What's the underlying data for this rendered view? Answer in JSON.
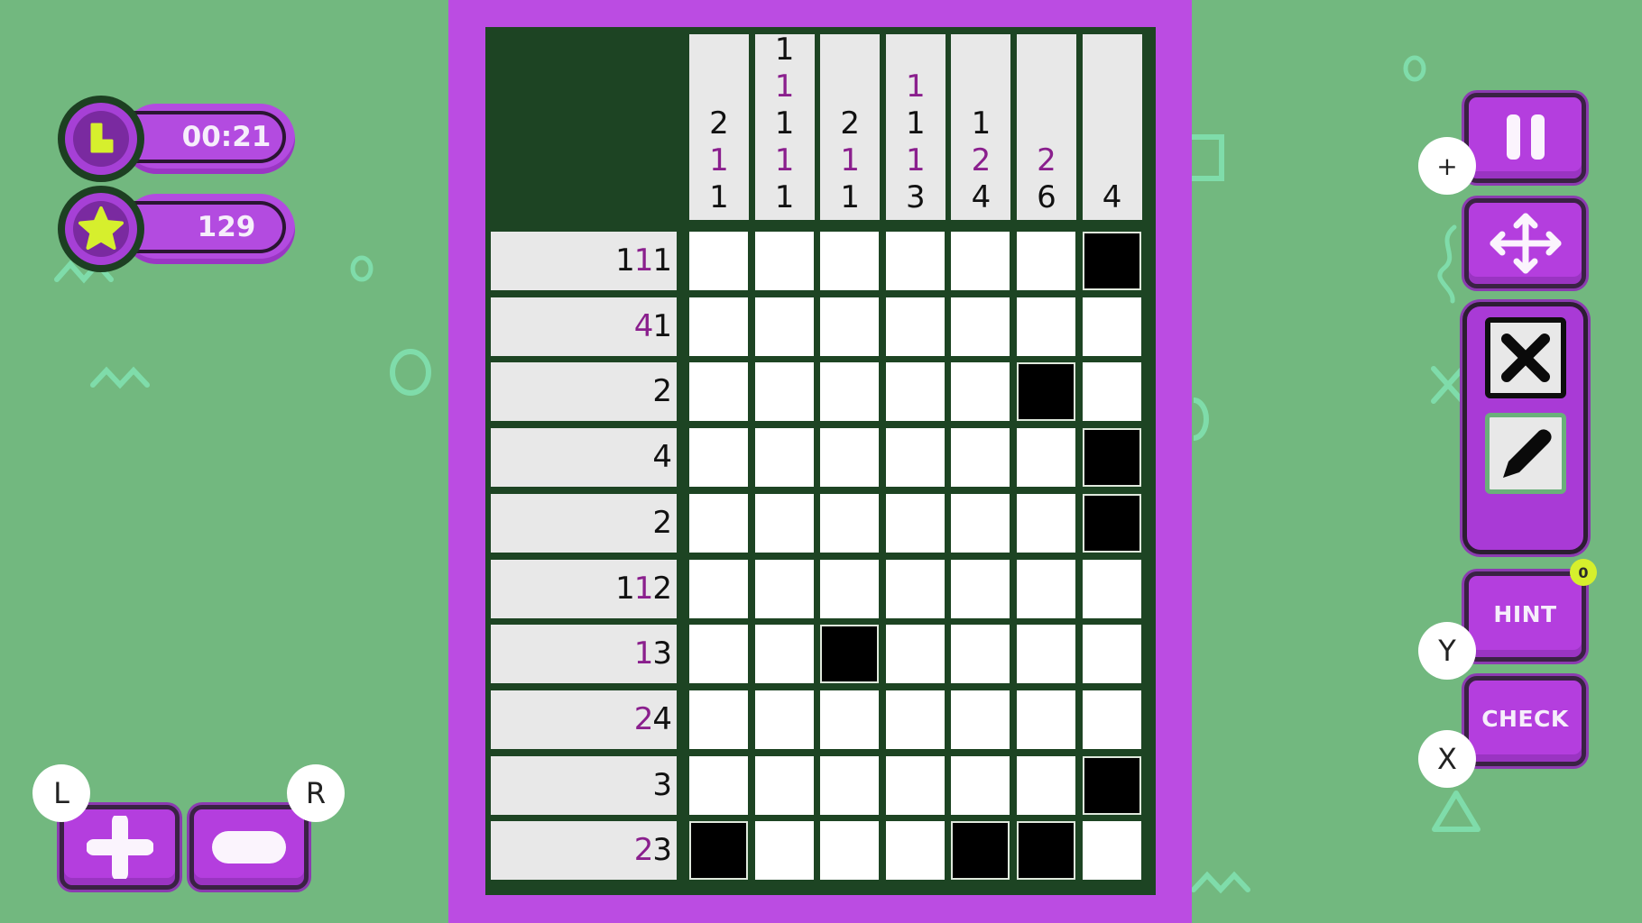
{
  "hud": {
    "timer": {
      "icon": "clock-icon",
      "value": "00:21"
    },
    "score": {
      "icon": "star-icon",
      "value": "129"
    }
  },
  "puzzle": {
    "rows": 10,
    "cols": 7,
    "column_clues": [
      [
        {
          "n": "2",
          "hl": false
        },
        {
          "n": "1",
          "hl": true
        },
        {
          "n": "1",
          "hl": false
        }
      ],
      [
        {
          "n": "1",
          "hl": false
        },
        {
          "n": "1",
          "hl": true
        },
        {
          "n": "1",
          "hl": false
        },
        {
          "n": "1",
          "hl": true
        },
        {
          "n": "1",
          "hl": false
        }
      ],
      [
        {
          "n": "2",
          "hl": false
        },
        {
          "n": "1",
          "hl": true
        },
        {
          "n": "1",
          "hl": false
        }
      ],
      [
        {
          "n": "1",
          "hl": true
        },
        {
          "n": "1",
          "hl": false
        },
        {
          "n": "1",
          "hl": true
        },
        {
          "n": "3",
          "hl": false
        }
      ],
      [
        {
          "n": "1",
          "hl": false
        },
        {
          "n": "2",
          "hl": true
        },
        {
          "n": "4",
          "hl": false
        }
      ],
      [
        {
          "n": "2",
          "hl": true
        },
        {
          "n": "6",
          "hl": false
        }
      ],
      [
        {
          "n": "4",
          "hl": false
        }
      ]
    ],
    "row_clues": [
      [
        {
          "n": "1",
          "hl": false
        },
        {
          "n": "1",
          "hl": true
        },
        {
          "n": "1",
          "hl": false
        }
      ],
      [
        {
          "n": "4",
          "hl": true
        },
        {
          "n": "1",
          "hl": false
        }
      ],
      [
        {
          "n": "2",
          "hl": false
        }
      ],
      [
        {
          "n": "4",
          "hl": false
        }
      ],
      [
        {
          "n": "2",
          "hl": false
        }
      ],
      [
        {
          "n": "1",
          "hl": false
        },
        {
          "n": "1",
          "hl": true
        },
        {
          "n": "2",
          "hl": false
        }
      ],
      [
        {
          "n": "1",
          "hl": true
        },
        {
          "n": "3",
          "hl": false
        }
      ],
      [
        {
          "n": "2",
          "hl": true
        },
        {
          "n": "4",
          "hl": false
        }
      ],
      [
        {
          "n": "3",
          "hl": false
        }
      ],
      [
        {
          "n": "2",
          "hl": true
        },
        {
          "n": "3",
          "hl": false
        }
      ]
    ],
    "cells": [
      [
        0,
        0,
        0,
        0,
        0,
        0,
        1
      ],
      [
        0,
        0,
        0,
        0,
        0,
        0,
        0
      ],
      [
        0,
        0,
        0,
        0,
        0,
        1,
        0
      ],
      [
        0,
        0,
        0,
        0,
        0,
        0,
        1
      ],
      [
        0,
        0,
        0,
        0,
        0,
        0,
        1
      ],
      [
        0,
        0,
        0,
        0,
        0,
        0,
        0
      ],
      [
        0,
        0,
        1,
        0,
        0,
        0,
        0
      ],
      [
        0,
        0,
        0,
        0,
        0,
        0,
        0
      ],
      [
        0,
        0,
        0,
        0,
        0,
        0,
        1
      ],
      [
        1,
        0,
        0,
        0,
        1,
        1,
        0
      ]
    ]
  },
  "controls": {
    "pause": {
      "icon": "pause-icon",
      "badge": "+"
    },
    "move": {
      "icon": "move-arrows-icon"
    },
    "tools": {
      "selected": "cross",
      "items": [
        {
          "id": "cross",
          "icon": "cross-icon"
        },
        {
          "id": "pencil",
          "icon": "pencil-icon"
        }
      ]
    },
    "hint": {
      "label": "HINT",
      "badge": "Y",
      "count": "0"
    },
    "check": {
      "label": "CHECK",
      "badge": "X"
    },
    "zoom_in": {
      "icon": "plus-icon",
      "badge": "L"
    },
    "zoom_out": {
      "icon": "minus-icon",
      "badge": "R"
    }
  },
  "colors": {
    "background": "#72b87f",
    "panel": "#bb4ce2",
    "grid": "#1d4423",
    "clue_highlight": "#8a1f8d",
    "accent_yellow": "#d6ef2d"
  }
}
